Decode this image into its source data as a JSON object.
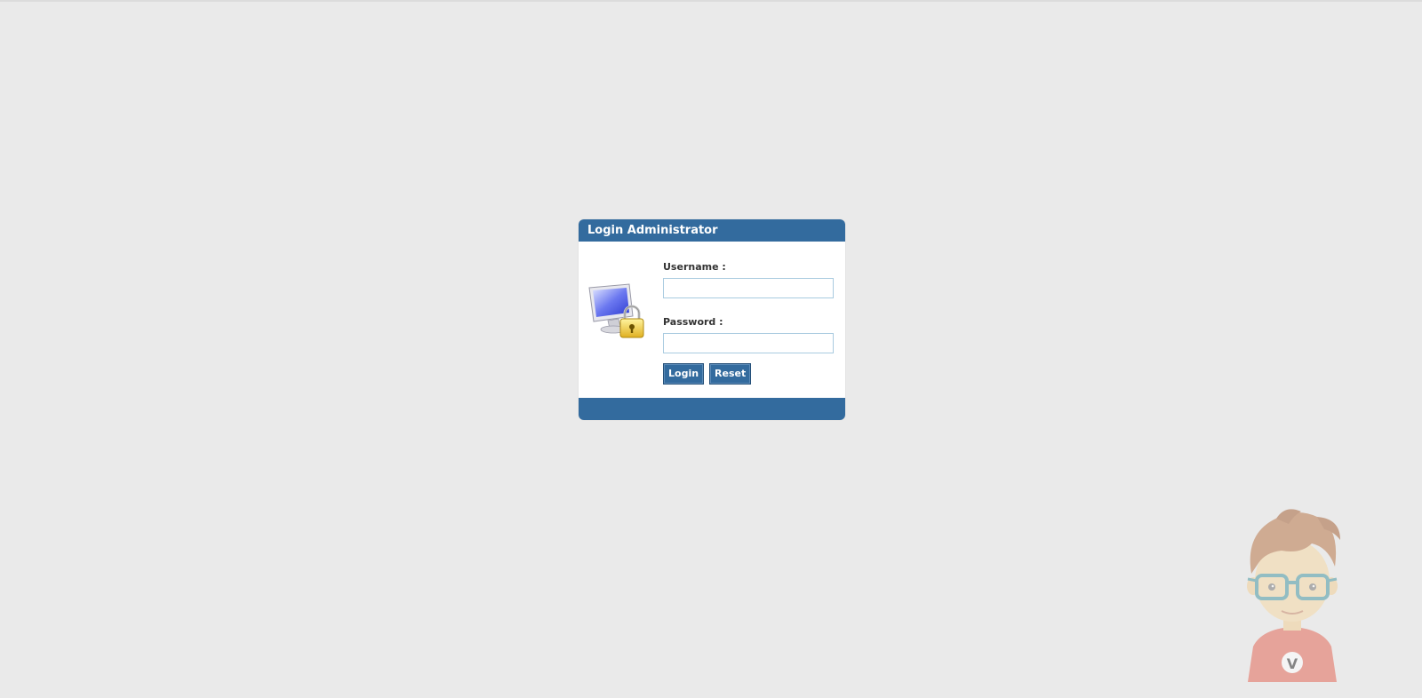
{
  "login": {
    "title": "Login Administrator",
    "username_label": "Username :",
    "username_value": "",
    "password_label": "Password :",
    "password_value": "",
    "login_button": "Login",
    "reset_button": "Reset"
  },
  "icons": {
    "login_icon": "computer-lock-icon",
    "mascot": "glasses-boy-mascot-v"
  },
  "colors": {
    "header": "#336b9e",
    "background": "#eaeaea",
    "input_border": "#a9cbe0"
  }
}
